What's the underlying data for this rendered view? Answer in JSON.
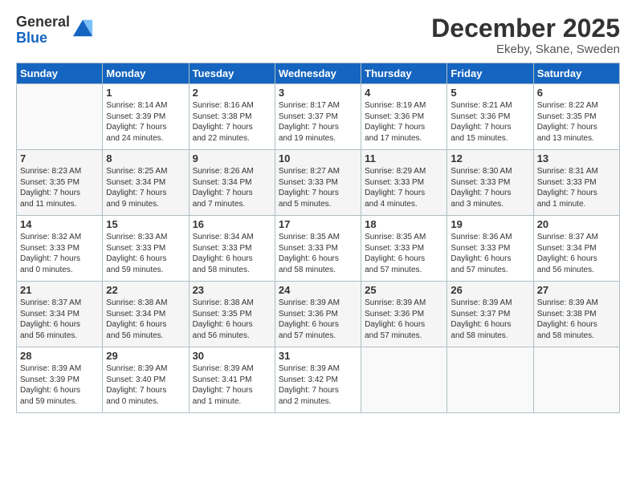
{
  "header": {
    "logo_general": "General",
    "logo_blue": "Blue",
    "month": "December 2025",
    "location": "Ekeby, Skane, Sweden"
  },
  "days_of_week": [
    "Sunday",
    "Monday",
    "Tuesday",
    "Wednesday",
    "Thursday",
    "Friday",
    "Saturday"
  ],
  "weeks": [
    [
      {
        "day": "",
        "info": ""
      },
      {
        "day": "1",
        "info": "Sunrise: 8:14 AM\nSunset: 3:39 PM\nDaylight: 7 hours\nand 24 minutes."
      },
      {
        "day": "2",
        "info": "Sunrise: 8:16 AM\nSunset: 3:38 PM\nDaylight: 7 hours\nand 22 minutes."
      },
      {
        "day": "3",
        "info": "Sunrise: 8:17 AM\nSunset: 3:37 PM\nDaylight: 7 hours\nand 19 minutes."
      },
      {
        "day": "4",
        "info": "Sunrise: 8:19 AM\nSunset: 3:36 PM\nDaylight: 7 hours\nand 17 minutes."
      },
      {
        "day": "5",
        "info": "Sunrise: 8:21 AM\nSunset: 3:36 PM\nDaylight: 7 hours\nand 15 minutes."
      },
      {
        "day": "6",
        "info": "Sunrise: 8:22 AM\nSunset: 3:35 PM\nDaylight: 7 hours\nand 13 minutes."
      }
    ],
    [
      {
        "day": "7",
        "info": "Sunrise: 8:23 AM\nSunset: 3:35 PM\nDaylight: 7 hours\nand 11 minutes."
      },
      {
        "day": "8",
        "info": "Sunrise: 8:25 AM\nSunset: 3:34 PM\nDaylight: 7 hours\nand 9 minutes."
      },
      {
        "day": "9",
        "info": "Sunrise: 8:26 AM\nSunset: 3:34 PM\nDaylight: 7 hours\nand 7 minutes."
      },
      {
        "day": "10",
        "info": "Sunrise: 8:27 AM\nSunset: 3:33 PM\nDaylight: 7 hours\nand 5 minutes."
      },
      {
        "day": "11",
        "info": "Sunrise: 8:29 AM\nSunset: 3:33 PM\nDaylight: 7 hours\nand 4 minutes."
      },
      {
        "day": "12",
        "info": "Sunrise: 8:30 AM\nSunset: 3:33 PM\nDaylight: 7 hours\nand 3 minutes."
      },
      {
        "day": "13",
        "info": "Sunrise: 8:31 AM\nSunset: 3:33 PM\nDaylight: 7 hours\nand 1 minute."
      }
    ],
    [
      {
        "day": "14",
        "info": "Sunrise: 8:32 AM\nSunset: 3:33 PM\nDaylight: 7 hours\nand 0 minutes."
      },
      {
        "day": "15",
        "info": "Sunrise: 8:33 AM\nSunset: 3:33 PM\nDaylight: 6 hours\nand 59 minutes."
      },
      {
        "day": "16",
        "info": "Sunrise: 8:34 AM\nSunset: 3:33 PM\nDaylight: 6 hours\nand 58 minutes."
      },
      {
        "day": "17",
        "info": "Sunrise: 8:35 AM\nSunset: 3:33 PM\nDaylight: 6 hours\nand 58 minutes."
      },
      {
        "day": "18",
        "info": "Sunrise: 8:35 AM\nSunset: 3:33 PM\nDaylight: 6 hours\nand 57 minutes."
      },
      {
        "day": "19",
        "info": "Sunrise: 8:36 AM\nSunset: 3:33 PM\nDaylight: 6 hours\nand 57 minutes."
      },
      {
        "day": "20",
        "info": "Sunrise: 8:37 AM\nSunset: 3:34 PM\nDaylight: 6 hours\nand 56 minutes."
      }
    ],
    [
      {
        "day": "21",
        "info": "Sunrise: 8:37 AM\nSunset: 3:34 PM\nDaylight: 6 hours\nand 56 minutes."
      },
      {
        "day": "22",
        "info": "Sunrise: 8:38 AM\nSunset: 3:34 PM\nDaylight: 6 hours\nand 56 minutes."
      },
      {
        "day": "23",
        "info": "Sunrise: 8:38 AM\nSunset: 3:35 PM\nDaylight: 6 hours\nand 56 minutes."
      },
      {
        "day": "24",
        "info": "Sunrise: 8:39 AM\nSunset: 3:36 PM\nDaylight: 6 hours\nand 57 minutes."
      },
      {
        "day": "25",
        "info": "Sunrise: 8:39 AM\nSunset: 3:36 PM\nDaylight: 6 hours\nand 57 minutes."
      },
      {
        "day": "26",
        "info": "Sunrise: 8:39 AM\nSunset: 3:37 PM\nDaylight: 6 hours\nand 58 minutes."
      },
      {
        "day": "27",
        "info": "Sunrise: 8:39 AM\nSunset: 3:38 PM\nDaylight: 6 hours\nand 58 minutes."
      }
    ],
    [
      {
        "day": "28",
        "info": "Sunrise: 8:39 AM\nSunset: 3:39 PM\nDaylight: 6 hours\nand 59 minutes."
      },
      {
        "day": "29",
        "info": "Sunrise: 8:39 AM\nSunset: 3:40 PM\nDaylight: 7 hours\nand 0 minutes."
      },
      {
        "day": "30",
        "info": "Sunrise: 8:39 AM\nSunset: 3:41 PM\nDaylight: 7 hours\nand 1 minute."
      },
      {
        "day": "31",
        "info": "Sunrise: 8:39 AM\nSunset: 3:42 PM\nDaylight: 7 hours\nand 2 minutes."
      },
      {
        "day": "",
        "info": ""
      },
      {
        "day": "",
        "info": ""
      },
      {
        "day": "",
        "info": ""
      }
    ]
  ]
}
